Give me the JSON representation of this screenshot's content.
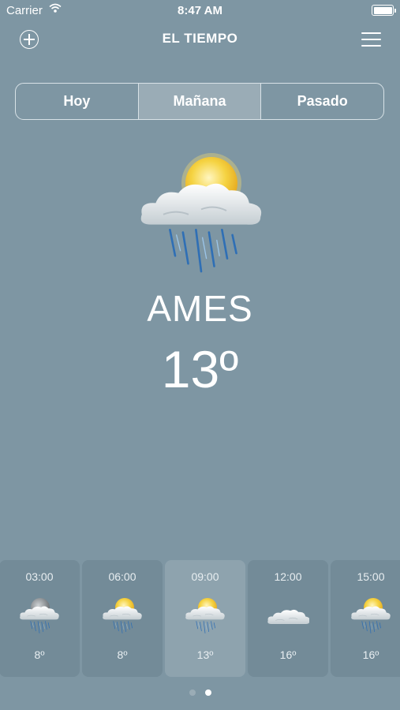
{
  "status_bar": {
    "carrier": "Carrier",
    "time": "8:47 AM"
  },
  "header": {
    "title": "EL TIEMPO"
  },
  "segments": [
    {
      "label": "Hoy",
      "selected": false
    },
    {
      "label": "Mañana",
      "selected": true
    },
    {
      "label": "Pasado",
      "selected": false
    }
  ],
  "main": {
    "icon": "sun-cloud-rain-icon",
    "city": "AMES",
    "temperature": "13º"
  },
  "hourly": [
    {
      "hour": "03:00",
      "temp": "8º",
      "icon": "moon-cloud-rain-icon"
    },
    {
      "hour": "06:00",
      "temp": "8º",
      "icon": "sun-cloud-rain-icon"
    },
    {
      "hour": "09:00",
      "temp": "13º",
      "icon": "sun-cloud-rain-icon",
      "selected": true
    },
    {
      "hour": "12:00",
      "temp": "16º",
      "icon": "cloud-icon"
    },
    {
      "hour": "15:00",
      "temp": "16º",
      "icon": "sun-cloud-rain-icon"
    }
  ],
  "page_indicator": {
    "pages": 2,
    "current": 2
  },
  "colors": {
    "background": "#7e96a3",
    "card": "#738b98",
    "card_selected": "#8ea3ae",
    "segment_selected": "#9aacb6",
    "sun": "#f6d233"
  }
}
